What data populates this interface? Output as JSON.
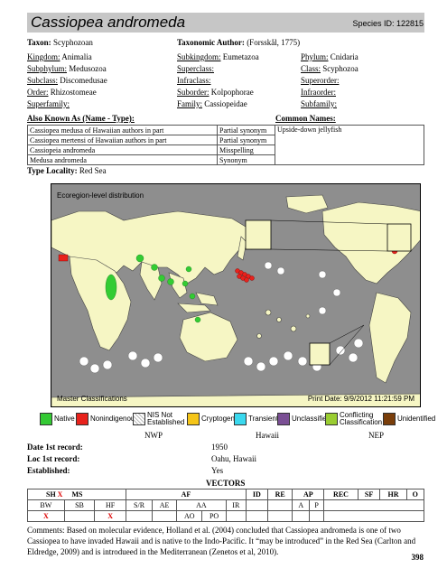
{
  "header": {
    "title": "Cassiopea andromeda",
    "species_id": "Species ID: 122815"
  },
  "taxon": {
    "taxon_label": "Taxon:",
    "taxon_value": "Scyphozoan",
    "author_label": "Taxonomic Author:",
    "author_value": "(Forsskål, 1775)"
  },
  "taxonomy": [
    {
      "label": "Kingdom:",
      "value": "Animalia"
    },
    {
      "label": "Subkingdom:",
      "value": "Eumetazoa"
    },
    {
      "label": "Phylum:",
      "value": "Cnidaria"
    },
    {
      "label": "Subphylum:",
      "value": "Medusozoa"
    },
    {
      "label": "Superclass:",
      "value": ""
    },
    {
      "label": "Class:",
      "value": "Scyphozoa"
    },
    {
      "label": "Subclass:",
      "value": "Discomedusae"
    },
    {
      "label": "Infraclass:",
      "value": ""
    },
    {
      "label": "Superorder:",
      "value": ""
    },
    {
      "label": "Order:",
      "value": "Rhizostomeae"
    },
    {
      "label": "Suborder:",
      "value": "Kolpophorae"
    },
    {
      "label": "Infraorder:",
      "value": ""
    },
    {
      "label": "Superfamily:",
      "value": ""
    },
    {
      "label": "Family:",
      "value": "Cassiopeidae"
    },
    {
      "label": "Subfamily:",
      "value": ""
    }
  ],
  "also_known_as": {
    "label": "Also Known As (Name - Type):",
    "common_label": "Common Names:",
    "names": [
      {
        "name": "Cassiopea medusa of Hawaiian authors in part",
        "type": "Partial synonym"
      },
      {
        "name": "Cassiopea mertensi of Hawaiian authors in part",
        "type": "Partial synonym"
      },
      {
        "name": "Cassiopeia andromeda",
        "type": "Misspelling"
      },
      {
        "name": "Medusa andromeda",
        "type": "Synonym"
      }
    ],
    "common_name": "Upside-down jellyfish"
  },
  "type_locality": {
    "label": "Type Locality:",
    "value": "Red Sea"
  },
  "map": {
    "caption": "Ecoregion-level distribution",
    "footer_left": "Master Classifications",
    "footer_right": "Print Date: 9/9/2012 11:21:59 PM",
    "ocean_color": "#8e8e8e",
    "land_color": "#f6f6c4",
    "native_color": "#33cc33",
    "nonindigenous_color": "#e8221c"
  },
  "legend": [
    {
      "label": "Native",
      "color": "#34c934"
    },
    {
      "label": "Nonindigenous",
      "color": "#e8221c"
    },
    {
      "label": "NIS Not Established",
      "color": "#ffffff"
    },
    {
      "label": "Cryptogenic",
      "color": "#f5c518"
    },
    {
      "label": "Transient",
      "color": "#3ad8ee"
    },
    {
      "label": "Unclassified",
      "color": "#7a4f94"
    },
    {
      "label": "Conflicting Classification",
      "color": "#9acd32"
    },
    {
      "label": "Unidentified",
      "color": "#7a3e0a"
    }
  ],
  "regions": {
    "nwp": "NWP",
    "hawaii": "Hawaii",
    "nep": "NEP"
  },
  "records": [
    {
      "label": "Date 1st record:",
      "nwp": "",
      "hawaii": "1950",
      "nep": ""
    },
    {
      "label": "Loc 1st record:",
      "nwp": "",
      "hawaii": "Oahu, Hawaii",
      "nep": ""
    },
    {
      "label": "Established:",
      "nwp": "",
      "hawaii": "Yes",
      "nep": ""
    }
  ],
  "vectors": {
    "title": "VECTORS",
    "header": [
      "SH",
      "X",
      "MS",
      "AF",
      "ID",
      "RE",
      "AP",
      "REC",
      "SF",
      "HR",
      "O"
    ],
    "sub": [
      "BW",
      "SB",
      "HF",
      "S/R",
      "AE",
      "AA",
      "IR",
      "A",
      "P"
    ],
    "sub2": [
      "AO",
      "PO"
    ],
    "marks": [
      "X",
      "X"
    ]
  },
  "comments": "Comments: Based on molecular evidence, Holland et al. (2004) concluded that Cassiopea andromeda is one of two Cassiopea to have invaded Hawaii and is native to the Indo-Pacific. It “may be introduced” in the Red Sea (Carlton and Eldredge, 2009) and is introdueed in the Mediterranean (Zenetos et al, 2010).",
  "page_number": "398"
}
